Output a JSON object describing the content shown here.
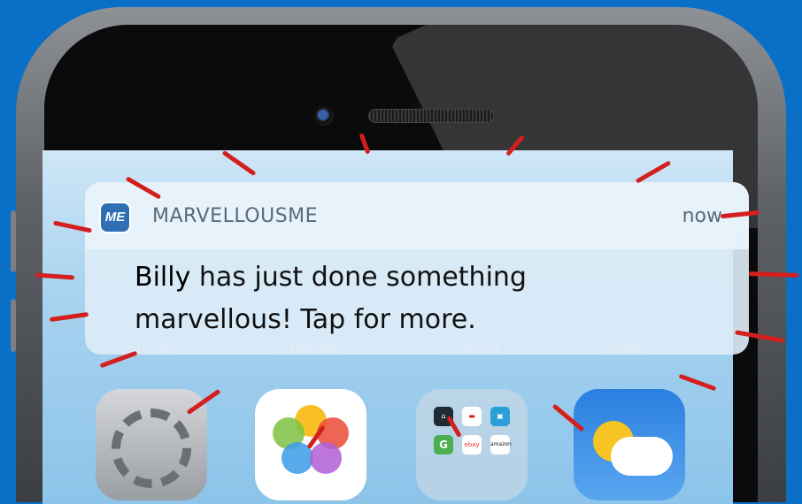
{
  "home_screen": {
    "app_labels": [
      "Social",
      "Calendar",
      "Camera",
      "Music"
    ],
    "icons": [
      "settings-icon",
      "photos-icon",
      "shopping-folder-icon",
      "weather-icon"
    ],
    "folder_apps": [
      "home-app-icon",
      "flag-app-icon",
      "bag-app-icon",
      "G",
      "ebay",
      "amazon"
    ]
  },
  "notification": {
    "app_icon_text": "ME",
    "app_name": "MARVELLOUSME",
    "time": "now",
    "name": "Billy",
    "message_line1_rest": " has just done something",
    "message_line2": "marvellous! Tap for more."
  },
  "colors": {
    "background": "#0a6fc6",
    "accent_red": "#d3201f",
    "app_icon": "#2f6fb3"
  }
}
